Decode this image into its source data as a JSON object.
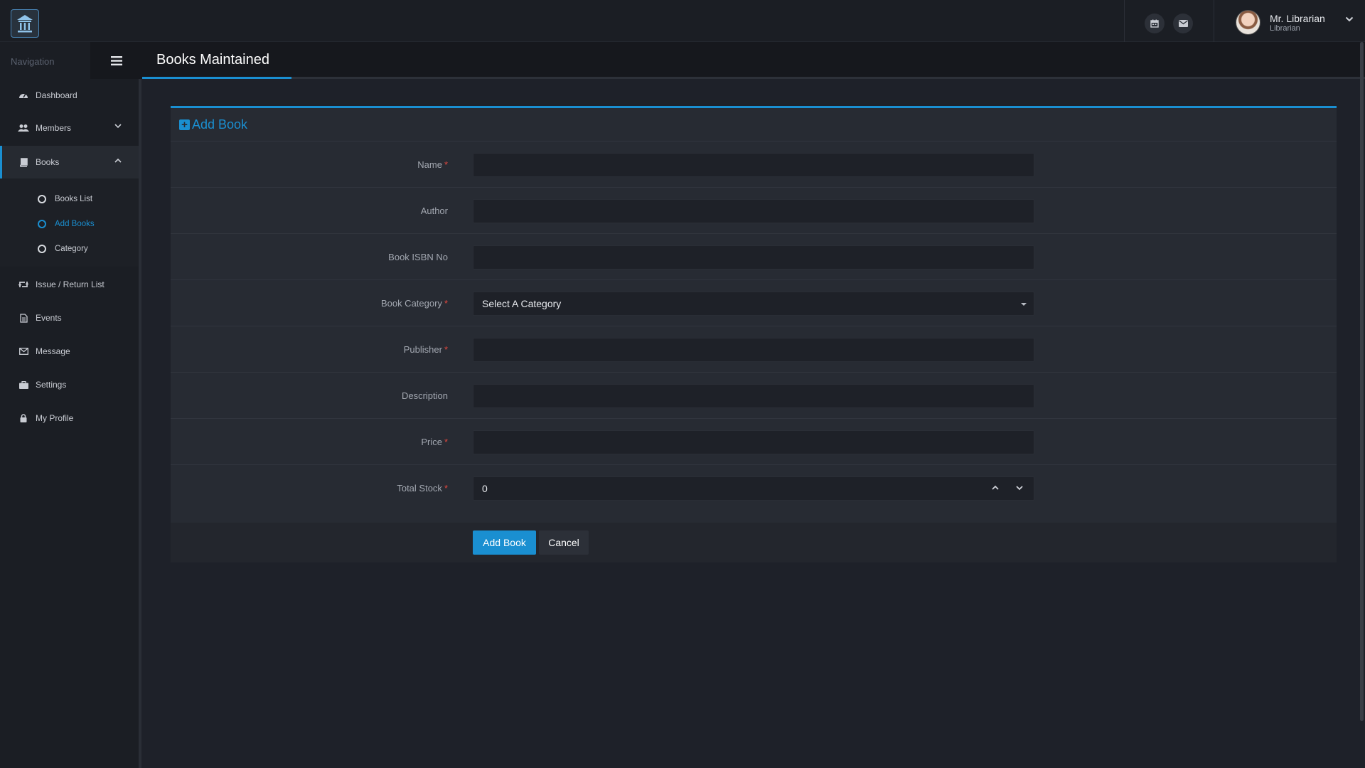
{
  "topbar": {
    "user_name": "Mr. Librarian",
    "user_role": "Librarian"
  },
  "sidebar": {
    "title": "Navigation",
    "items": [
      {
        "label": "Dashboard",
        "icon": "dashboard-icon"
      },
      {
        "label": "Members",
        "icon": "users-icon"
      },
      {
        "label": "Books",
        "icon": "book-icon"
      },
      {
        "label": "Issue / Return List",
        "icon": "retweet-icon"
      },
      {
        "label": "Events",
        "icon": "document-icon"
      },
      {
        "label": "Message",
        "icon": "envelope-icon"
      },
      {
        "label": "Settings",
        "icon": "briefcase-icon"
      },
      {
        "label": "My Profile",
        "icon": "lock-icon"
      }
    ],
    "books_submenu": [
      {
        "label": "Books List"
      },
      {
        "label": "Add Books"
      },
      {
        "label": "Category"
      }
    ]
  },
  "page": {
    "title": "Books Maintained"
  },
  "form": {
    "heading": "Add Book",
    "fields": {
      "name": {
        "label": "Name",
        "required": "*",
        "value": ""
      },
      "author": {
        "label": "Author",
        "value": ""
      },
      "isbn": {
        "label": "Book ISBN No",
        "value": ""
      },
      "category": {
        "label": "Book Category",
        "required": "*",
        "value": "Select A Category"
      },
      "publisher": {
        "label": "Publisher",
        "required": "*",
        "value": ""
      },
      "description": {
        "label": "Description",
        "value": ""
      },
      "price": {
        "label": "Price",
        "required": "*",
        "value": ""
      },
      "total_stock": {
        "label": "Total Stock",
        "required": "*",
        "value": "0"
      }
    },
    "submit_label": "Add Book",
    "cancel_label": "Cancel"
  },
  "colors": {
    "accent": "#1a8fd1",
    "required": "#e0483f",
    "background": "#1e2129",
    "panel": "#272b33"
  }
}
